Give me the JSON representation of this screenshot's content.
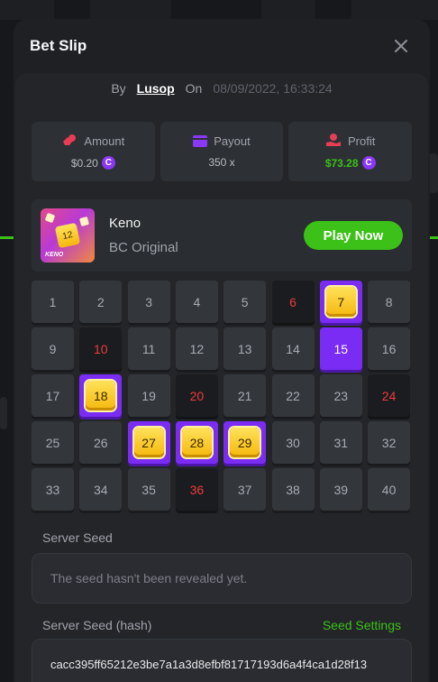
{
  "modal": {
    "title": "Bet Slip"
  },
  "byline": {
    "by_label": "By",
    "user": "Lusop",
    "on_label": "On",
    "date": "08/09/2022, 16:33:24"
  },
  "stats": [
    {
      "label": "Amount",
      "value": "$0.20",
      "icon": "money-bag-icon",
      "coin": true,
      "color": "#b9bcc2"
    },
    {
      "label": "Payout",
      "value": "350 x",
      "icon": "card-icon",
      "coin": false,
      "color": "#b9bcc2"
    },
    {
      "label": "Profit",
      "value": "$73.28",
      "icon": "hand-money-icon",
      "coin": true,
      "color": "#3bc117"
    }
  ],
  "game": {
    "name": "Keno",
    "subtitle": "BC Original",
    "thumb_text": "KENO",
    "thumb_tile": "12",
    "play_label": "Play Now"
  },
  "grid": {
    "tiles": [
      {
        "n": "1",
        "s": "none"
      },
      {
        "n": "2",
        "s": "none"
      },
      {
        "n": "3",
        "s": "none"
      },
      {
        "n": "4",
        "s": "none"
      },
      {
        "n": "5",
        "s": "none"
      },
      {
        "n": "6",
        "s": "miss"
      },
      {
        "n": "7",
        "s": "gem"
      },
      {
        "n": "8",
        "s": "none"
      },
      {
        "n": "9",
        "s": "none"
      },
      {
        "n": "10",
        "s": "miss"
      },
      {
        "n": "11",
        "s": "none"
      },
      {
        "n": "12",
        "s": "none"
      },
      {
        "n": "13",
        "s": "none"
      },
      {
        "n": "14",
        "s": "none"
      },
      {
        "n": "15",
        "s": "sel"
      },
      {
        "n": "16",
        "s": "none"
      },
      {
        "n": "17",
        "s": "none"
      },
      {
        "n": "18",
        "s": "gem"
      },
      {
        "n": "19",
        "s": "none"
      },
      {
        "n": "20",
        "s": "miss"
      },
      {
        "n": "21",
        "s": "none"
      },
      {
        "n": "22",
        "s": "none"
      },
      {
        "n": "23",
        "s": "none"
      },
      {
        "n": "24",
        "s": "miss"
      },
      {
        "n": "25",
        "s": "none"
      },
      {
        "n": "26",
        "s": "none"
      },
      {
        "n": "27",
        "s": "gem"
      },
      {
        "n": "28",
        "s": "gem"
      },
      {
        "n": "29",
        "s": "gem"
      },
      {
        "n": "30",
        "s": "none"
      },
      {
        "n": "31",
        "s": "none"
      },
      {
        "n": "32",
        "s": "none"
      },
      {
        "n": "33",
        "s": "none"
      },
      {
        "n": "34",
        "s": "none"
      },
      {
        "n": "35",
        "s": "none"
      },
      {
        "n": "36",
        "s": "miss"
      },
      {
        "n": "37",
        "s": "none"
      },
      {
        "n": "38",
        "s": "none"
      },
      {
        "n": "39",
        "s": "none"
      },
      {
        "n": "40",
        "s": "none"
      }
    ]
  },
  "server_seed": {
    "label": "Server Seed",
    "value": "The seed hasn't been revealed yet."
  },
  "server_seed_hash": {
    "label": "Server Seed (hash)",
    "settings_link": "Seed Settings",
    "value": "cacc395ff65212e3be7a1a3d8efbf81717193d6a4f4ca1d28f13"
  },
  "colors": {
    "accent_purple": "#7a2cf5",
    "accent_green": "#3bc117",
    "miss_red": "#ed3c3c"
  }
}
